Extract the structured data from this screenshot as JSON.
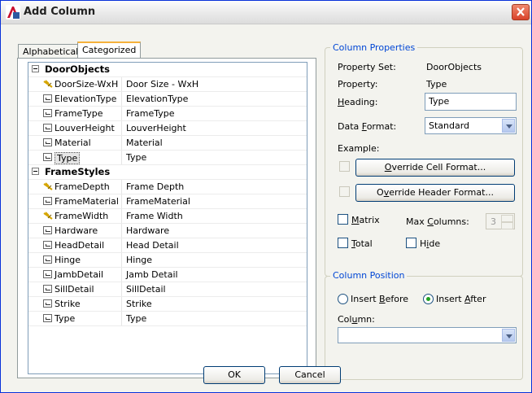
{
  "window": {
    "title": "Add Column"
  },
  "tabs": [
    {
      "label": "Alphabetical",
      "active": false
    },
    {
      "label": "Categorized",
      "active": true
    }
  ],
  "tree": [
    {
      "type": "category",
      "name": "DoorObjects"
    },
    {
      "type": "property",
      "icon": "calculated-property-icon",
      "name": "DoorSize-WxH",
      "value": "Door Size - WxH"
    },
    {
      "type": "property",
      "icon": "property-icon",
      "name": "ElevationType",
      "value": "ElevationType"
    },
    {
      "type": "property",
      "icon": "property-icon",
      "name": "FrameType",
      "value": "FrameType"
    },
    {
      "type": "property",
      "icon": "property-icon",
      "name": "LouverHeight",
      "value": "LouverHeight"
    },
    {
      "type": "property",
      "icon": "property-icon",
      "name": "Material",
      "value": "Material"
    },
    {
      "type": "property",
      "icon": "property-icon",
      "name": "Type",
      "value": "Type",
      "selected": true
    },
    {
      "type": "category",
      "name": "FrameStyles"
    },
    {
      "type": "property",
      "icon": "calculated-property-icon",
      "name": "FrameDepth",
      "value": "Frame Depth"
    },
    {
      "type": "property",
      "icon": "property-icon",
      "name": "FrameMaterial",
      "value": "FrameMaterial"
    },
    {
      "type": "property",
      "icon": "calculated-property-icon",
      "name": "FrameWidth",
      "value": "Frame Width"
    },
    {
      "type": "property",
      "icon": "property-icon",
      "name": "Hardware",
      "value": "Hardware"
    },
    {
      "type": "property",
      "icon": "property-icon",
      "name": "HeadDetail",
      "value": "Head Detail"
    },
    {
      "type": "property",
      "icon": "property-icon",
      "name": "Hinge",
      "value": "Hinge"
    },
    {
      "type": "property",
      "icon": "property-icon",
      "name": "JambDetail",
      "value": "Jamb Detail"
    },
    {
      "type": "property",
      "icon": "property-icon",
      "name": "SillDetail",
      "value": "SillDetail"
    },
    {
      "type": "property",
      "icon": "property-icon",
      "name": "Strike",
      "value": "Strike"
    },
    {
      "type": "property",
      "icon": "property-icon",
      "name": "Type",
      "value": "Type"
    }
  ],
  "column_properties": {
    "legend": "Column Properties",
    "property_set_label": "Property Set:",
    "property_set_value": "DoorObjects",
    "property_label": "Property:",
    "property_value": "Type",
    "heading_label": "Heading:",
    "heading_value": "Type",
    "data_format_label": "Data Format:",
    "data_format_value": "Standard",
    "example_label": "Example:",
    "override_cell_button": "Override Cell Format...",
    "override_header_button": "Override Header Format...",
    "matrix_label": "Matrix",
    "max_columns_label": "Max Columns:",
    "max_columns_value": "3",
    "total_label": "Total",
    "hide_label": "Hide"
  },
  "column_position": {
    "legend": "Column Position",
    "insert_before_label": "Insert Before",
    "insert_after_label": "Insert After",
    "selected": "insert_after",
    "column_label": "Column:",
    "column_value": ""
  },
  "buttons": {
    "ok": "OK",
    "cancel": "Cancel"
  },
  "colors": {
    "accent_tab": "#f5b13c",
    "group_legend": "#0046d5",
    "close": "#d9432a"
  }
}
